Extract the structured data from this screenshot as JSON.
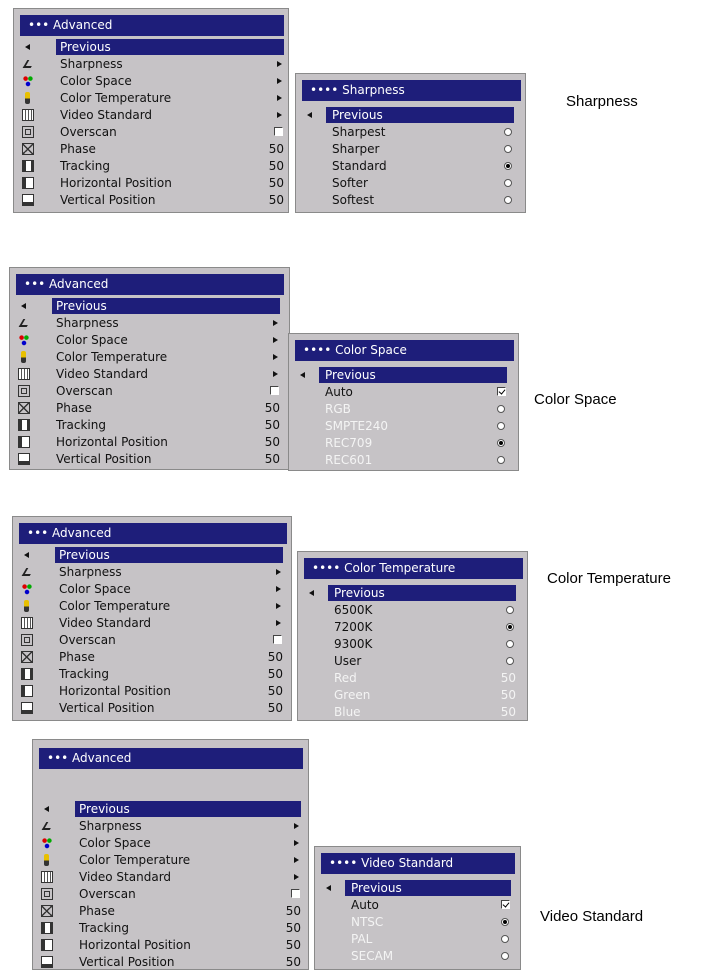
{
  "advanced_menu": {
    "title": "••• Advanced",
    "items": [
      {
        "label": "Previous",
        "icon": "left-arrow-icon",
        "value": "",
        "control": "none"
      },
      {
        "label": "Sharpness",
        "icon": "sharpness-icon",
        "value": "",
        "control": "submenu-arrow"
      },
      {
        "label": "Color Space",
        "icon": "color-space-icon",
        "value": "",
        "control": "submenu-arrow"
      },
      {
        "label": "Color Temperature",
        "icon": "color-temperature-icon",
        "value": "",
        "control": "submenu-arrow"
      },
      {
        "label": "Video Standard",
        "icon": "video-standard-icon",
        "value": "",
        "control": "submenu-arrow"
      },
      {
        "label": "Overscan",
        "icon": "overscan-icon",
        "value": "",
        "control": "checkbox-unchecked"
      },
      {
        "label": "Phase",
        "icon": "phase-icon",
        "value": "50",
        "control": "value"
      },
      {
        "label": "Tracking",
        "icon": "tracking-icon",
        "value": "50",
        "control": "value"
      },
      {
        "label": "Horizontal Position",
        "icon": "horizontal-position-icon",
        "value": "50",
        "control": "value"
      },
      {
        "label": "Vertical Position",
        "icon": "vertical-position-icon",
        "value": "50",
        "control": "value"
      }
    ]
  },
  "submenus": [
    {
      "title": "•••• Sharpness",
      "caption": "Sharpness",
      "items": [
        {
          "label": "Previous",
          "control": "none",
          "enabled": true
        },
        {
          "label": "Sharpest",
          "control": "radio",
          "selected": false,
          "enabled": true
        },
        {
          "label": "Sharper",
          "control": "radio",
          "selected": false,
          "enabled": true
        },
        {
          "label": "Standard",
          "control": "radio",
          "selected": true,
          "enabled": true
        },
        {
          "label": "Softer",
          "control": "radio",
          "selected": false,
          "enabled": true
        },
        {
          "label": "Softest",
          "control": "radio",
          "selected": false,
          "enabled": true
        }
      ]
    },
    {
      "title": "•••• Color Space",
      "caption": "Color Space",
      "items": [
        {
          "label": "Previous",
          "control": "none",
          "enabled": true
        },
        {
          "label": "Auto",
          "control": "checkbox",
          "selected": true,
          "enabled": true
        },
        {
          "label": "RGB",
          "control": "radio",
          "selected": false,
          "enabled": false
        },
        {
          "label": "SMPTE240",
          "control": "radio",
          "selected": false,
          "enabled": false
        },
        {
          "label": "REC709",
          "control": "radio",
          "selected": true,
          "enabled": false
        },
        {
          "label": "REC601",
          "control": "radio",
          "selected": false,
          "enabled": false
        }
      ]
    },
    {
      "title": "•••• Color Temperature",
      "caption": "Color Temperature",
      "items": [
        {
          "label": "Previous",
          "control": "none",
          "enabled": true
        },
        {
          "label": "6500K",
          "control": "radio",
          "selected": false,
          "enabled": true
        },
        {
          "label": "7200K",
          "control": "radio",
          "selected": true,
          "enabled": true
        },
        {
          "label": "9300K",
          "control": "radio",
          "selected": false,
          "enabled": true
        },
        {
          "label": "User",
          "control": "radio",
          "selected": false,
          "enabled": true
        },
        {
          "label": "Red",
          "control": "value",
          "value": "50",
          "enabled": false
        },
        {
          "label": "Green",
          "control": "value",
          "value": "50",
          "enabled": false
        },
        {
          "label": "Blue",
          "control": "value",
          "value": "50",
          "enabled": false
        }
      ]
    },
    {
      "title": "•••• Video Standard",
      "caption": "Video Standard",
      "items": [
        {
          "label": "Previous",
          "control": "none",
          "enabled": true
        },
        {
          "label": "Auto",
          "control": "checkbox",
          "selected": true,
          "enabled": true
        },
        {
          "label": "NTSC",
          "control": "radio",
          "selected": true,
          "enabled": false
        },
        {
          "label": "PAL",
          "control": "radio",
          "selected": false,
          "enabled": false
        },
        {
          "label": "SECAM",
          "control": "radio",
          "selected": false,
          "enabled": false
        }
      ]
    }
  ],
  "colors": {
    "titlebar": "#1e1e7a",
    "panel": "#c6c3c6",
    "highlight": "#1e1e7a",
    "disabled_text": "#f4f4f4"
  }
}
